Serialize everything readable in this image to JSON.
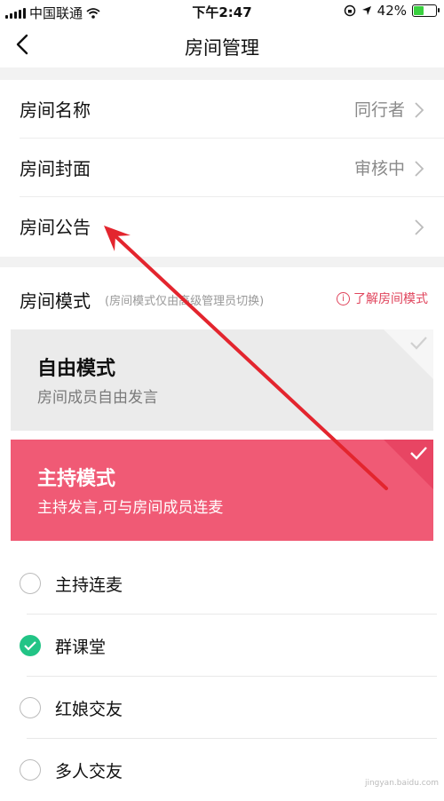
{
  "status_bar": {
    "carrier": "中国联通",
    "time": "下午2:47",
    "battery": "42%"
  },
  "nav": {
    "title": "房间管理"
  },
  "settings": [
    {
      "label": "房间名称",
      "value": "同行者"
    },
    {
      "label": "房间封面",
      "value": "审核中"
    },
    {
      "label": "房间公告",
      "value": ""
    }
  ],
  "mode_section": {
    "label": "房间模式",
    "hint": "(房间模式仅由高级管理员切换)",
    "learn_more": "了解房间模式"
  },
  "modes": [
    {
      "title": "自由模式",
      "desc": "房间成员自由发言",
      "selected": false
    },
    {
      "title": "主持模式",
      "desc": "主持发言,可与房间成员连麦",
      "selected": true
    }
  ],
  "options": [
    {
      "label": "主持连麦",
      "checked": false
    },
    {
      "label": "群课堂",
      "checked": true
    },
    {
      "label": "红娘交友",
      "checked": false
    },
    {
      "label": "多人交友",
      "checked": false
    }
  ],
  "watermark": "jingyan.baidu.com",
  "colors": {
    "accent": "#f05a75",
    "check_green": "#22c486",
    "link_red": "#e0445c"
  }
}
